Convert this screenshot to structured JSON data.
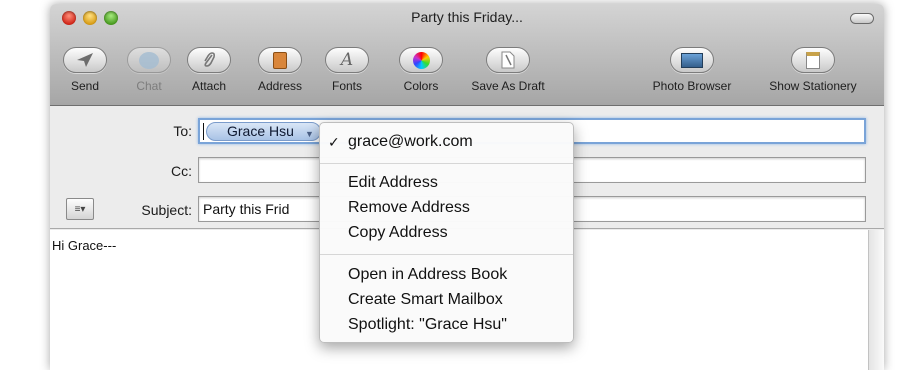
{
  "window": {
    "title": "Party this Friday..."
  },
  "toolbar": {
    "items": [
      {
        "label": "Send",
        "icon": "paper-plane-icon",
        "enabled": true
      },
      {
        "label": "Chat",
        "icon": "chat-bubble-icon",
        "enabled": false
      },
      {
        "label": "Attach",
        "icon": "paperclip-icon",
        "enabled": true
      },
      {
        "label": "Address",
        "icon": "address-book-icon",
        "enabled": true
      },
      {
        "label": "Fonts",
        "icon": "fonts-icon",
        "enabled": true
      },
      {
        "label": "Colors",
        "icon": "color-wheel-icon",
        "enabled": true
      },
      {
        "label": "Save As Draft",
        "icon": "draft-icon",
        "enabled": true
      },
      {
        "label": "Photo Browser",
        "icon": "photo-browser-icon",
        "enabled": true
      },
      {
        "label": "Show Stationery",
        "icon": "stationery-icon",
        "enabled": true
      }
    ]
  },
  "header": {
    "to_label": "To:",
    "to_token": "Grace Hsu",
    "cc_label": "Cc:",
    "cc_value": "",
    "subject_label": "Subject:",
    "subject_value": "Party this Frid",
    "action_glyph": "≡▾"
  },
  "body": {
    "text": "Hi Grace---"
  },
  "context_menu": {
    "checked_item": "grace@work.com",
    "group1": [
      "Edit Address",
      "Remove Address",
      "Copy Address"
    ],
    "group2": [
      "Open in Address Book",
      "Create Smart Mailbox",
      "Spotlight: \"Grace Hsu\""
    ]
  },
  "colors": {
    "token_fill": "#a9c3e6",
    "focus_ring": "#7aa4d8"
  }
}
